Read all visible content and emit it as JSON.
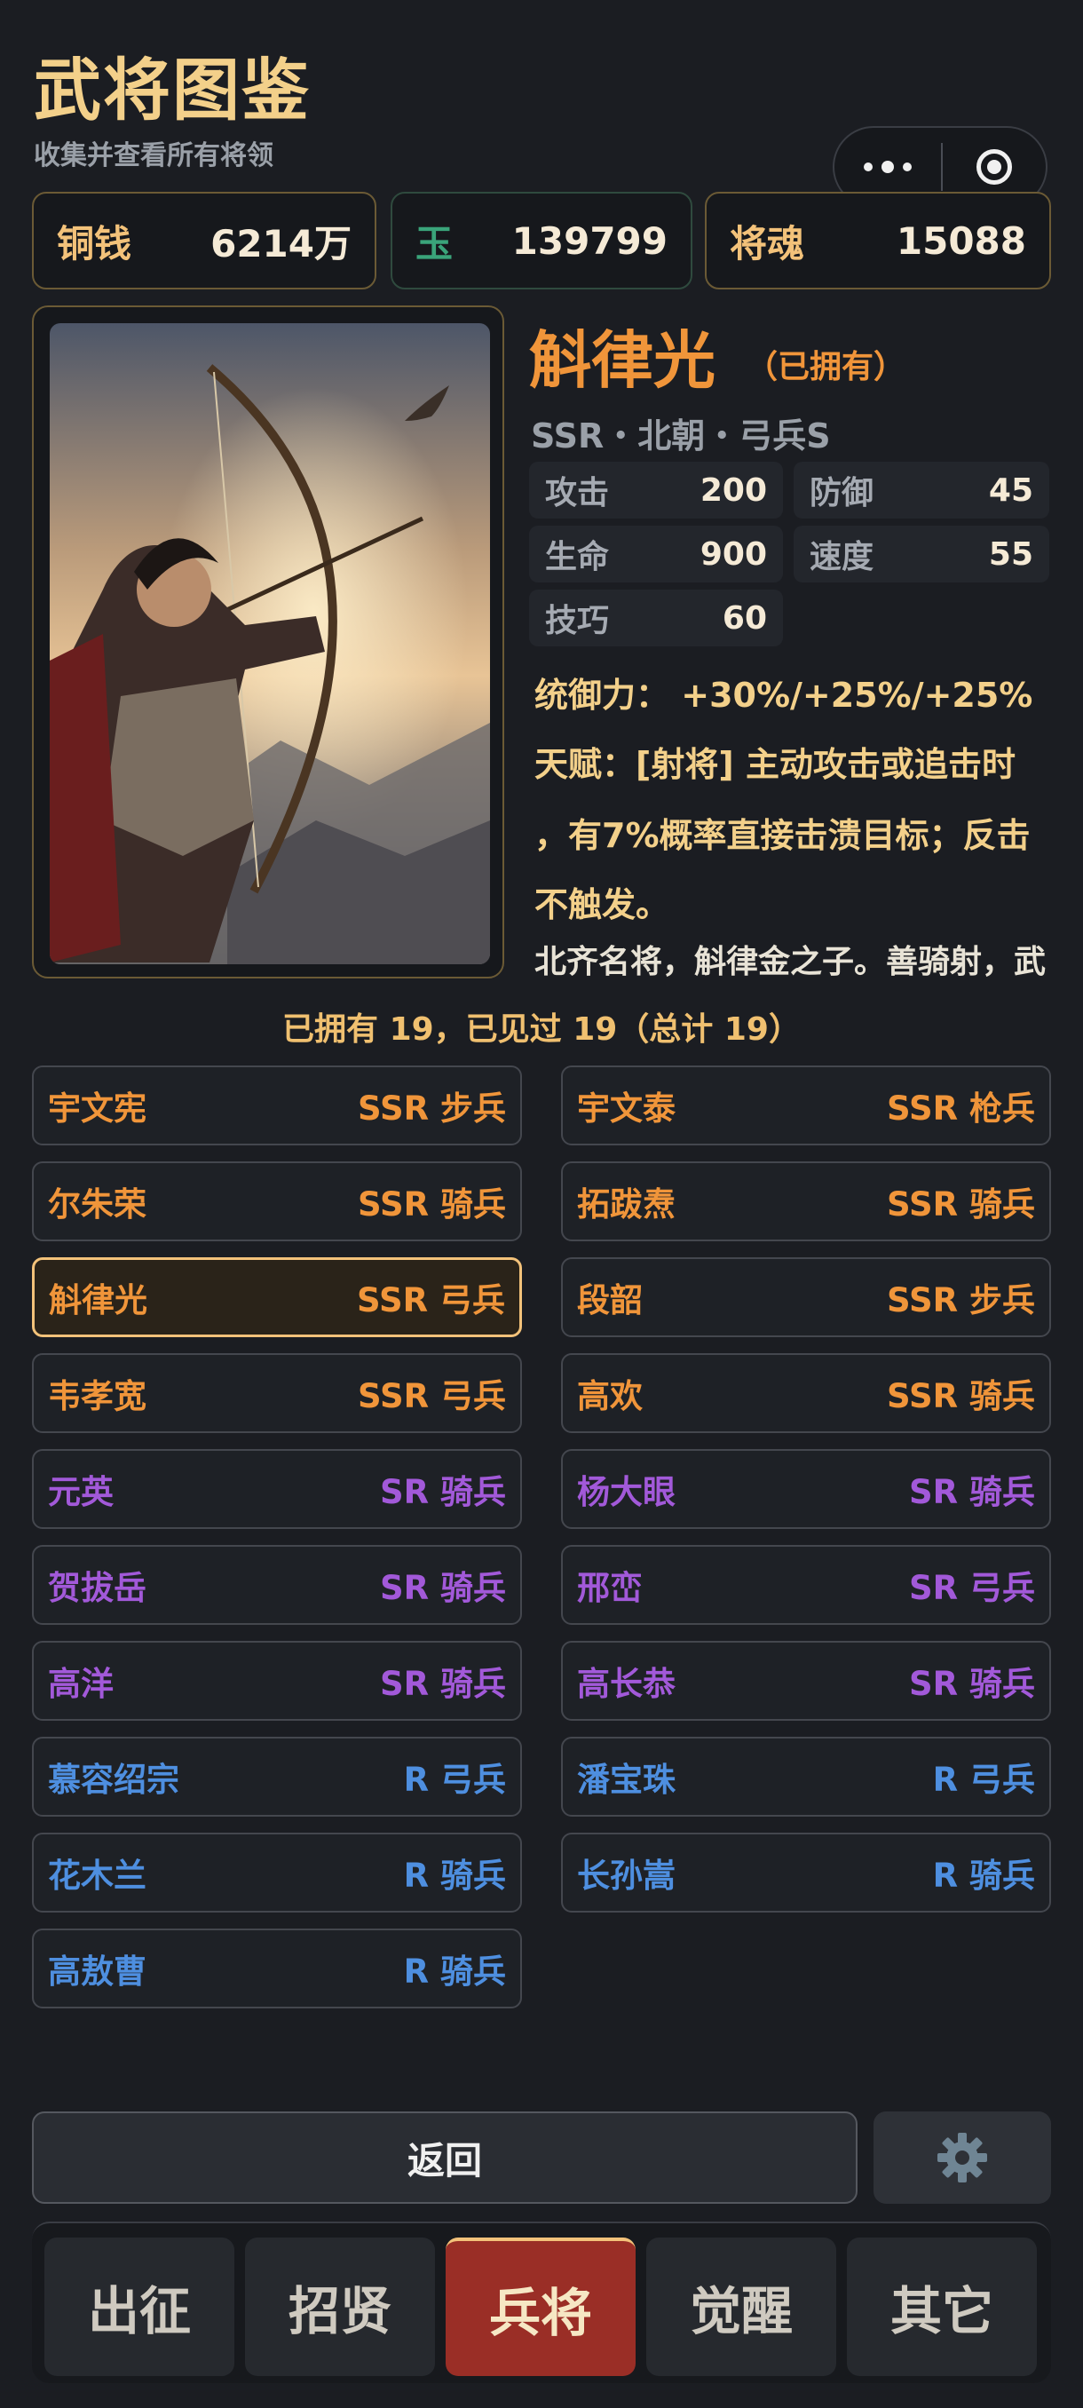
{
  "header": {
    "title": "武将图鉴",
    "subtitle": "收集并查看所有将领"
  },
  "currencies": [
    {
      "name": "铜钱",
      "value": "6214万"
    },
    {
      "name": "玉",
      "value": "139799"
    },
    {
      "name": "将魂",
      "value": "15088"
    }
  ],
  "hero": {
    "name": "斛律光",
    "owned": "（已拥有）",
    "meta": "SSR・北朝・弓兵S",
    "stats": [
      {
        "label": "攻击",
        "value": "200"
      },
      {
        "label": "防御",
        "value": "45"
      },
      {
        "label": "生命",
        "value": "900"
      },
      {
        "label": "速度",
        "value": "55"
      },
      {
        "label": "技巧",
        "value": "60"
      }
    ],
    "command": "统御力： +30%/+25%/+25%",
    "talent_lines": [
      "天赋：[射将] 主动攻击或追击时",
      "，有7%概率直接击溃目标；反击",
      "不触发。"
    ],
    "description": "北齐名将，斛律金之子。善骑射，武"
  },
  "summary": "已拥有 19，已见过 19（总计 19）",
  "roster": [
    {
      "name": "宇文宪",
      "rarity": "SSR",
      "type": "步兵"
    },
    {
      "name": "宇文泰",
      "rarity": "SSR",
      "type": "枪兵"
    },
    {
      "name": "尔朱荣",
      "rarity": "SSR",
      "type": "骑兵"
    },
    {
      "name": "拓跋焘",
      "rarity": "SSR",
      "type": "骑兵"
    },
    {
      "name": "斛律光",
      "rarity": "SSR",
      "type": "弓兵"
    },
    {
      "name": "段韶",
      "rarity": "SSR",
      "type": "步兵"
    },
    {
      "name": "韦孝宽",
      "rarity": "SSR",
      "type": "弓兵"
    },
    {
      "name": "高欢",
      "rarity": "SSR",
      "type": "骑兵"
    },
    {
      "name": "元英",
      "rarity": "SR",
      "type": "骑兵"
    },
    {
      "name": "杨大眼",
      "rarity": "SR",
      "type": "骑兵"
    },
    {
      "name": "贺拔岳",
      "rarity": "SR",
      "type": "骑兵"
    },
    {
      "name": "邢峦",
      "rarity": "SR",
      "type": "弓兵"
    },
    {
      "name": "高洋",
      "rarity": "SR",
      "type": "骑兵"
    },
    {
      "name": "高长恭",
      "rarity": "SR",
      "type": "骑兵"
    },
    {
      "name": "慕容绍宗",
      "rarity": "R",
      "type": "弓兵"
    },
    {
      "name": "潘宝珠",
      "rarity": "R",
      "type": "弓兵"
    },
    {
      "name": "花木兰",
      "rarity": "R",
      "type": "骑兵"
    },
    {
      "name": "长孙嵩",
      "rarity": "R",
      "type": "骑兵"
    },
    {
      "name": "高敖曹",
      "rarity": "R",
      "type": "骑兵"
    }
  ],
  "selected_index": 4,
  "colors": {
    "SSR": "#f0953a",
    "SR": "#a259d9",
    "R": "#4e8fe0",
    "accent": "#f3c27a",
    "active_tab": "#9a2e26"
  },
  "actions": {
    "back_label": "返回",
    "settings_icon": "gear-icon"
  },
  "tabs": [
    {
      "label": "出征",
      "active": false
    },
    {
      "label": "招贤",
      "active": false
    },
    {
      "label": "兵将",
      "active": true
    },
    {
      "label": "觉醒",
      "active": false
    },
    {
      "label": "其它",
      "active": false
    }
  ]
}
